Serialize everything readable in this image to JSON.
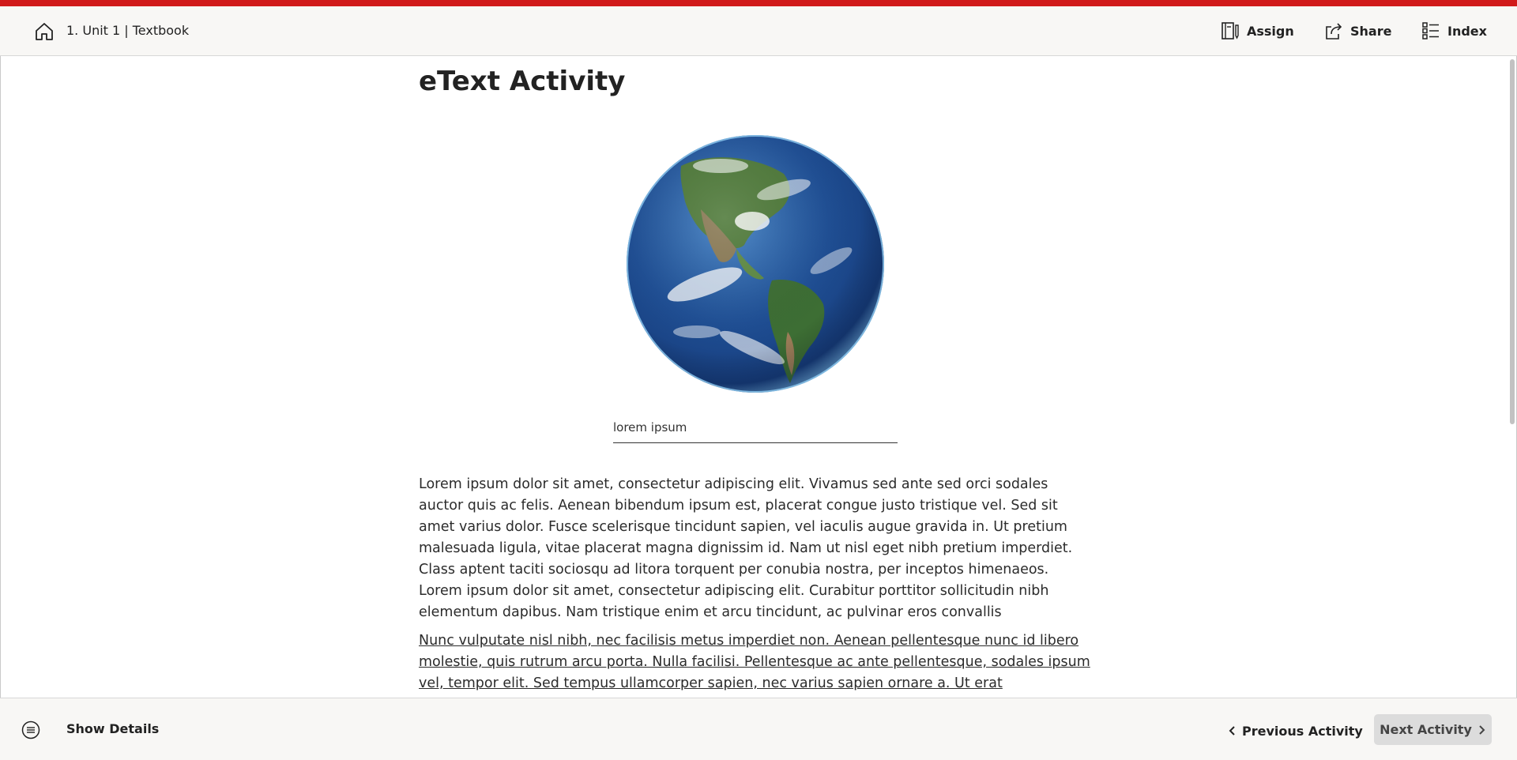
{
  "header": {
    "breadcrumb": "1. Unit 1 | Textbook",
    "assign_label": "Assign",
    "share_label": "Share",
    "index_label": "Index"
  },
  "main": {
    "title": "eText Activity",
    "image_caption": "lorem ipsum",
    "paragraph_1": "Lorem ipsum dolor sit amet, consectetur adipiscing elit. Vivamus sed ante sed orci sodales auctor quis ac felis. Aenean bibendum ipsum est, placerat congue justo tristique vel. Sed sit amet varius dolor. Fusce scelerisque tincidunt sapien, vel iaculis augue gravida in. Ut pretium malesuada ligula, vitae placerat magna dignissim id. Nam ut nisl eget nibh pretium imperdiet. Class aptent taciti sociosqu ad litora torquent per conubia nostra, per inceptos himenaeos. Lorem ipsum dolor sit amet, consectetur adipiscing elit. Curabitur porttitor sollicitudin nibh elementum dapibus. Nam tristique enim et arcu tincidunt, ac pulvinar eros convallis",
    "paragraph_2": "Nunc vulputate nisl nibh, nec facilisis metus imperdiet non. Aenean pellentesque nunc id libero molestie, quis rutrum arcu porta. Nulla facilisi. Pellentesque ac ante pellentesque, sodales ipsum vel, tempor elit. Sed tempus ullamcorper sapien, nec varius sapien ornare a. Ut erat"
  },
  "footer": {
    "show_details_label": "Show Details",
    "previous_label": "Previous Activity",
    "next_label": "Next Activity"
  },
  "colors": {
    "accent_stripe": "#d11a1a",
    "header_bg": "#f8f7f5",
    "next_button_bg": "#dcdcdc"
  },
  "icons": {
    "home": "home-icon",
    "assign": "assign-icon",
    "share": "share-icon",
    "index": "list-icon",
    "details": "details-icon",
    "previous": "chevron-left-icon",
    "next": "chevron-right-icon"
  }
}
